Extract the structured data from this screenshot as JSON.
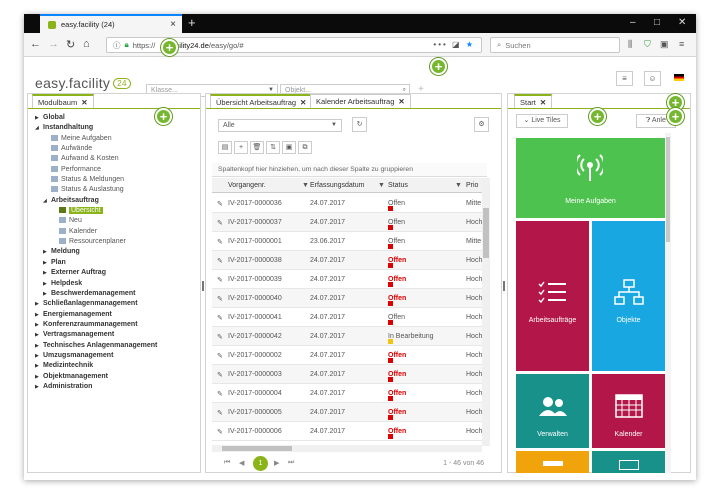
{
  "browser": {
    "tab_title": "easy.facility (24)",
    "url_prefix": "https://",
    "url_host": "facility24.de",
    "url_path": "/easy/go/#",
    "search_placeholder": "Suchen"
  },
  "header": {
    "logo": "easy.facility",
    "logo_num": "24",
    "select1_placeholder": "Klasse...",
    "select2_placeholder": "Objekt..."
  },
  "left": {
    "tab": "Modulbaum",
    "tree": [
      {
        "t": "Global",
        "lvl": 0,
        "exp": "collapsed"
      },
      {
        "t": "Instandhaltung",
        "lvl": 0,
        "exp": "expanded"
      },
      {
        "t": "Meine Aufgaben",
        "lvl": 1,
        "leaf": true
      },
      {
        "t": "Aufwände",
        "lvl": 1,
        "leaf": true
      },
      {
        "t": "Aufwand & Kosten",
        "lvl": 1,
        "leaf": true
      },
      {
        "t": "Performance",
        "lvl": 1,
        "leaf": true
      },
      {
        "t": "Status & Meldungen",
        "lvl": 1,
        "leaf": true
      },
      {
        "t": "Status & Auslastung",
        "lvl": 1,
        "leaf": true
      },
      {
        "t": "Arbeitsauftrag",
        "lvl": 1,
        "exp": "expanded"
      },
      {
        "t": "Übersicht",
        "lvl": 2,
        "leaf": true,
        "selected": true
      },
      {
        "t": "Neu",
        "lvl": 2,
        "leaf": true
      },
      {
        "t": "Kalender",
        "lvl": 2,
        "leaf": true
      },
      {
        "t": "Ressourcenplaner",
        "lvl": 2,
        "leaf": true
      },
      {
        "t": "Meldung",
        "lvl": 1,
        "exp": "collapsed"
      },
      {
        "t": "Plan",
        "lvl": 1,
        "exp": "collapsed"
      },
      {
        "t": "Externer Auftrag",
        "lvl": 1,
        "exp": "collapsed"
      },
      {
        "t": "Helpdesk",
        "lvl": 1,
        "exp": "collapsed"
      },
      {
        "t": "Beschwerdemanagement",
        "lvl": 1,
        "exp": "collapsed"
      },
      {
        "t": "Schließanlagenmanagement",
        "lvl": 0,
        "exp": "collapsed"
      },
      {
        "t": "Energiemanagement",
        "lvl": 0,
        "exp": "collapsed"
      },
      {
        "t": "Konferenzraummanagement",
        "lvl": 0,
        "exp": "collapsed"
      },
      {
        "t": "Vertragsmanagement",
        "lvl": 0,
        "exp": "collapsed"
      },
      {
        "t": "Technisches Anlagenmanagement",
        "lvl": 0,
        "exp": "collapsed"
      },
      {
        "t": "Umzugsmanagement",
        "lvl": 0,
        "exp": "collapsed"
      },
      {
        "t": "Medizintechnik",
        "lvl": 0,
        "exp": "collapsed"
      },
      {
        "t": "Objektmanagement",
        "lvl": 0,
        "exp": "collapsed"
      },
      {
        "t": "Administration",
        "lvl": 0,
        "exp": "collapsed"
      }
    ]
  },
  "middle": {
    "tab1": "Übersicht Arbeitsauftrag",
    "tab2": "Kalender Arbeitsauftrag",
    "filter": "Alle",
    "group_hint": "Spaltenkopf hier hinziehen, um nach dieser Spalte zu gruppieren",
    "columns": [
      "Vorgangenr.",
      "Erfassungsdatum",
      "Status",
      "Prio"
    ],
    "rows": [
      {
        "id": "IV-2017-0000036",
        "date": "24.07.2017",
        "status": "Offen",
        "bold": false,
        "color": "#d00",
        "prio": "Mitte"
      },
      {
        "id": "IV-2017-0000037",
        "date": "24.07.2017",
        "status": "Offen",
        "bold": false,
        "color": "#d00",
        "prio": "Hoch"
      },
      {
        "id": "IV-2017-0000001",
        "date": "23.06.2017",
        "status": "Offen",
        "bold": false,
        "color": "#d00",
        "prio": "Mitte"
      },
      {
        "id": "IV-2017-0000038",
        "date": "24.07.2017",
        "status": "Offen",
        "bold": true,
        "color": "#d00",
        "prio": "Hoch"
      },
      {
        "id": "IV-2017-0000039",
        "date": "24.07.2017",
        "status": "Offen",
        "bold": true,
        "color": "#d00",
        "prio": "Hoch"
      },
      {
        "id": "IV-2017-0000040",
        "date": "24.07.2017",
        "status": "Offen",
        "bold": true,
        "color": "#d00",
        "prio": "Hoch"
      },
      {
        "id": "IV-2017-0000041",
        "date": "24.07.2017",
        "status": "Offen",
        "bold": false,
        "color": "#d00",
        "prio": "Hoch"
      },
      {
        "id": "IV-2017-0000042",
        "date": "24.07.2017",
        "status": "In Bearbeitung",
        "bold": false,
        "color": "#f1c40f",
        "prio": "Hoch"
      },
      {
        "id": "IV-2017-0000002",
        "date": "24.07.2017",
        "status": "Offen",
        "bold": true,
        "color": "#d00",
        "prio": "Hoch"
      },
      {
        "id": "IV-2017-0000003",
        "date": "24.07.2017",
        "status": "Offen",
        "bold": true,
        "color": "#d00",
        "prio": "Hoch"
      },
      {
        "id": "IV-2017-0000004",
        "date": "24.07.2017",
        "status": "Offen",
        "bold": true,
        "color": "#d00",
        "prio": "Hoch"
      },
      {
        "id": "IV-2017-0000005",
        "date": "24.07.2017",
        "status": "Offen",
        "bold": true,
        "color": "#d00",
        "prio": "Hoch"
      },
      {
        "id": "IV-2017-0000006",
        "date": "24.07.2017",
        "status": "Offen",
        "bold": true,
        "color": "#d00",
        "prio": "Hoch"
      }
    ],
    "page": "1",
    "count": "1 - 46 von 46"
  },
  "right": {
    "tab": "Start",
    "live_tiles": "Live Tiles",
    "anleitung": "Anle",
    "tiles": [
      {
        "label": "Meine Aufgaben",
        "color": "#4ec24e",
        "icon": "antenna-icon"
      },
      {
        "label": "Arbeitsaufträge",
        "color": "#b3174a",
        "icon": "checklist-icon"
      },
      {
        "label": "Objekte",
        "color": "#18a7e0",
        "icon": "sitemap-icon"
      },
      {
        "label": "Verwalten",
        "color": "#17918a",
        "icon": "users-icon"
      },
      {
        "label": "Kalender",
        "color": "#b3174a",
        "icon": "calendar-icon"
      }
    ]
  }
}
